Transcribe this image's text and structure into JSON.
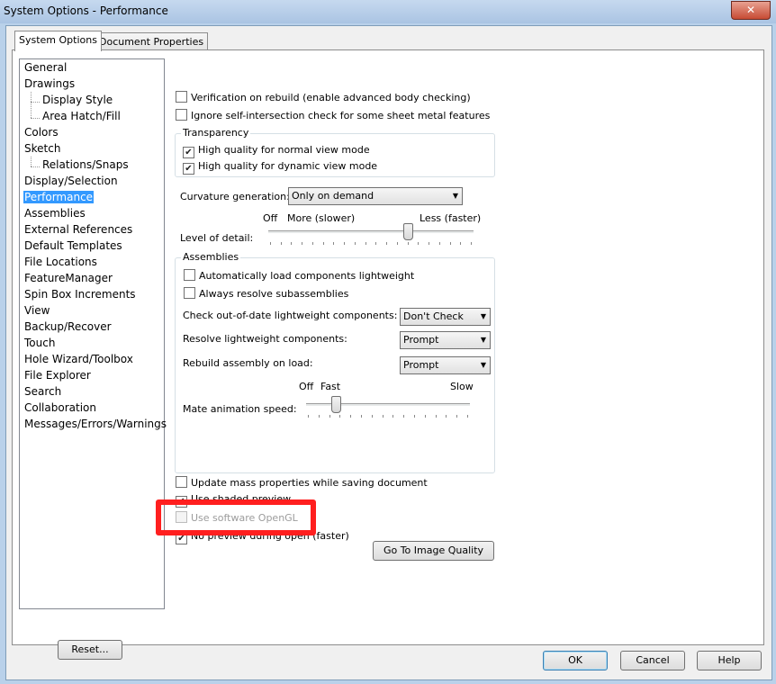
{
  "window": {
    "title": "System Options - Performance",
    "close_label": "✕"
  },
  "tabs": [
    {
      "label": "System Options",
      "active": true
    },
    {
      "label": "Document Properties",
      "active": false
    }
  ],
  "tree": {
    "items": [
      {
        "label": "General",
        "indent": 0
      },
      {
        "label": "Drawings",
        "indent": 0
      },
      {
        "label": "Display Style",
        "indent": 1
      },
      {
        "label": "Area Hatch/Fill",
        "indent": 1
      },
      {
        "label": "Colors",
        "indent": 0
      },
      {
        "label": "Sketch",
        "indent": 0
      },
      {
        "label": "Relations/Snaps",
        "indent": 1
      },
      {
        "label": "Display/Selection",
        "indent": 0
      },
      {
        "label": "Performance",
        "indent": 0,
        "selected": true
      },
      {
        "label": "Assemblies",
        "indent": 0
      },
      {
        "label": "External References",
        "indent": 0
      },
      {
        "label": "Default Templates",
        "indent": 0
      },
      {
        "label": "File Locations",
        "indent": 0
      },
      {
        "label": "FeatureManager",
        "indent": 0
      },
      {
        "label": "Spin Box Increments",
        "indent": 0
      },
      {
        "label": "View",
        "indent": 0
      },
      {
        "label": "Backup/Recover",
        "indent": 0
      },
      {
        "label": "Touch",
        "indent": 0
      },
      {
        "label": "Hole Wizard/Toolbox",
        "indent": 0
      },
      {
        "label": "File Explorer",
        "indent": 0
      },
      {
        "label": "Search",
        "indent": 0
      },
      {
        "label": "Collaboration",
        "indent": 0
      },
      {
        "label": "Messages/Errors/Warnings",
        "indent": 0
      }
    ]
  },
  "reset_label": "Reset...",
  "options": {
    "verification": {
      "label": "Verification on rebuild (enable advanced body checking)",
      "checked": false
    },
    "ignore_self_intersection": {
      "label": "Ignore self-intersection check for some sheet metal features",
      "checked": false
    }
  },
  "transparency": {
    "title": "Transparency",
    "normal": {
      "label": "High quality for normal view mode",
      "checked": true
    },
    "dynamic": {
      "label": "High quality for dynamic view mode",
      "checked": true
    }
  },
  "curvature": {
    "label": "Curvature generation:",
    "value": "Only on demand"
  },
  "detail": {
    "label": "Level of detail:",
    "off": "Off",
    "more": "More (slower)",
    "less": "Less (faster)",
    "level": 0.68
  },
  "assemblies": {
    "title": "Assemblies",
    "auto_lightweight": {
      "label": "Automatically load components lightweight",
      "checked": false
    },
    "resolve_sub": {
      "label": "Always resolve subassemblies",
      "checked": false
    },
    "check_outofdate": {
      "label": "Check out-of-date lightweight components:",
      "value": "Don't Check"
    },
    "resolve_lightweight": {
      "label": "Resolve lightweight components:",
      "value": "Prompt"
    },
    "rebuild_on_load": {
      "label": "Rebuild assembly on load:",
      "value": "Prompt"
    },
    "mate_speed": {
      "label": "Mate animation speed:",
      "off": "Off",
      "fast": "Fast",
      "slow": "Slow",
      "level": 0.18
    }
  },
  "bottom_options": {
    "mass_props": {
      "label": "Update mass properties while saving document",
      "checked": false
    },
    "shaded_preview": {
      "label": "Use shaded preview",
      "checked": true
    },
    "software_opengl": {
      "label": "Use software OpenGL",
      "checked": false,
      "disabled": true
    },
    "no_preview": {
      "label": "No preview during open (faster)",
      "checked": true
    }
  },
  "goto_image_quality": "Go To Image Quality",
  "footer": {
    "ok": "OK",
    "cancel": "Cancel",
    "help": "Help"
  },
  "highlight_color": "#ff1f1f"
}
